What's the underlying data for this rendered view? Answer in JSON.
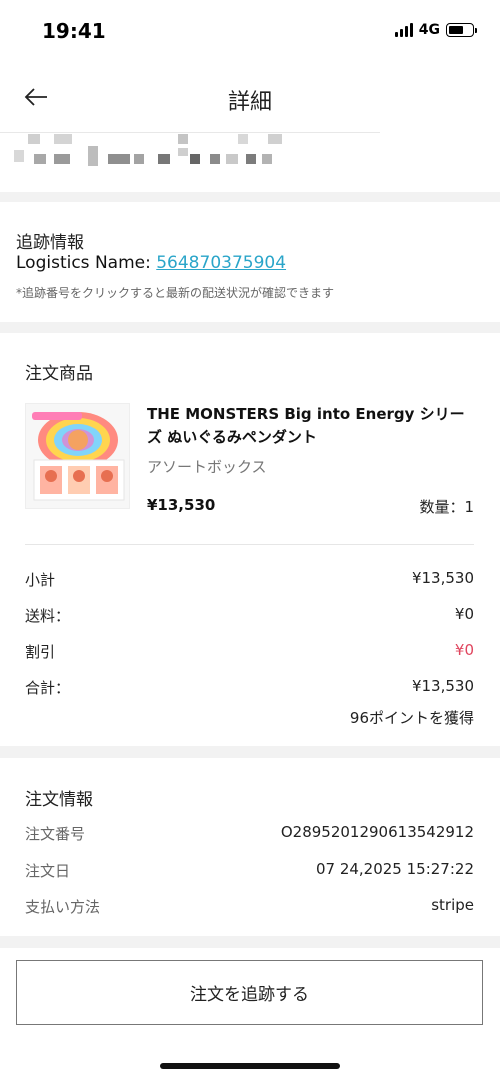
{
  "status_bar": {
    "time": "19:41",
    "network": "4G",
    "battery_level": 0.62
  },
  "nav": {
    "title": "詳細",
    "back_icon": "arrow-left-icon"
  },
  "tracking": {
    "title": "追跡情報",
    "logistics_label": "Logistics Name: ",
    "tracking_number": "564870375904",
    "note": "*追跡番号をクリックすると最新の配送状況が確認できます"
  },
  "order_items": {
    "title": "注文商品",
    "product": {
      "name": "THE MONSTERS Big into Energy シリーズ ぬいぐるみペンダント",
      "variant": "アソートボックス",
      "price": "¥13,530",
      "quantity": "数量：1"
    },
    "summary": [
      {
        "label": "小計",
        "value": "¥13,530"
      },
      {
        "label": "送料：",
        "value": "¥0"
      },
      {
        "label": "割引",
        "value": "¥0"
      },
      {
        "label": "合計：",
        "value": "¥13,530"
      }
    ],
    "points": "96ポイントを獲得",
    "accent_colors": {
      "link": "#2aa5c9",
      "discount": "#e0455e"
    }
  },
  "order_info": {
    "title": "注文情報",
    "rows": [
      {
        "label": "注文番号",
        "value": "O2895201290613542912"
      },
      {
        "label": "注文日",
        "value": "07 24,2025 15:27:22"
      },
      {
        "label": "支払い方法",
        "value": "stripe"
      }
    ]
  },
  "bottom": {
    "track_button": "注文を追跡する"
  }
}
